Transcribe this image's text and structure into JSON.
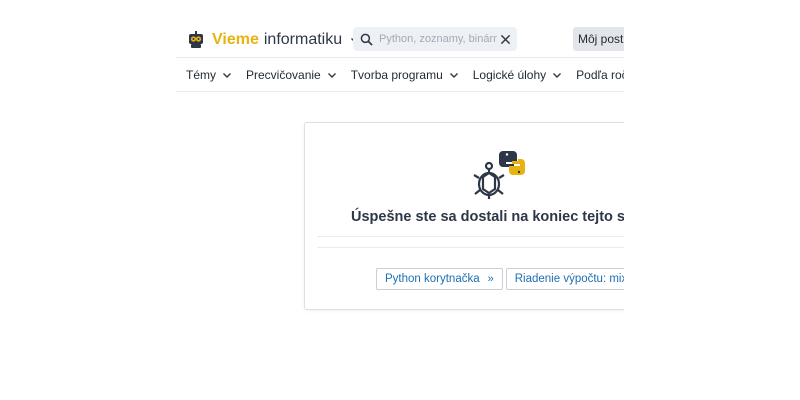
{
  "brand": {
    "name_part1": "Vieme",
    "name_part2": "informatiku",
    "accent_color": "#e7b40f",
    "logo_icon": "robot-icon"
  },
  "search": {
    "placeholder": "Python, zoznamy, binárne čísla",
    "icon": "search-icon",
    "clear_icon": "close-icon"
  },
  "header": {
    "progress_label": "Môj postup"
  },
  "nav": {
    "items": [
      {
        "label": "Témy"
      },
      {
        "label": "Precvičovanie"
      },
      {
        "label": "Tvorba programu"
      },
      {
        "label": "Logické úlohy"
      },
      {
        "label": "Podľa ročníka"
      }
    ]
  },
  "card": {
    "icon": "python-turtle-icon",
    "title": "Úspešne ste sa dostali na koniec tejto súpravy",
    "links": [
      {
        "label": "Python korytnačka",
        "suffix": "»"
      },
      {
        "label": "Riadenie výpočtu: mix",
        "suffix": "»"
      }
    ]
  }
}
